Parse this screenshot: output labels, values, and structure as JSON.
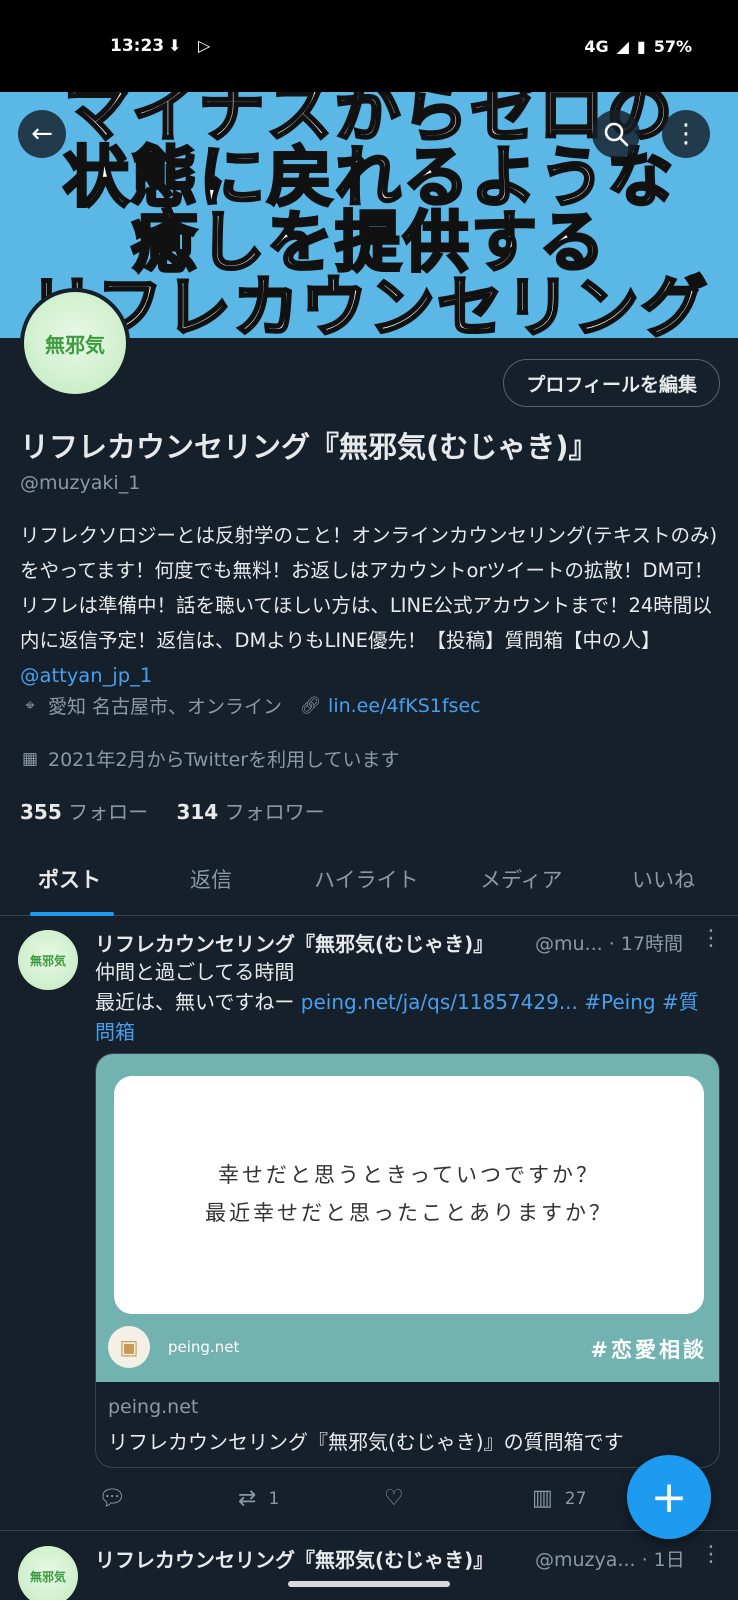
{
  "status_bar": {
    "time": "13:23",
    "network": "4G",
    "battery": "57%"
  },
  "banner": {
    "lines": [
      "マイナスからゼロの",
      "状態に戻れるような",
      "癒しを提供する",
      "リフレカウンセリング"
    ]
  },
  "profile": {
    "avatar_text": "無邪気",
    "edit_button": "プロフィールを編集",
    "name": "リフレカウンセリング『無邪気(むじゃき)』",
    "handle": "@muzyaki_1",
    "bio": "リフレクソロジーとは反射学のこと！オンラインカウンセリング(テキストのみ)をやってます！何度でも無料！お返しはアカウントorツイートの拡散！DM可！リフレは準備中！話を聴いてほしい方は、LINE公式アカウントまで！24時間以内に返信予定！返信は、DMよりもLINE優先！【投稿】質問箱【中の人】",
    "bio_mention": "@attyan_jp_1",
    "location": "愛知 名古屋市、オンライン",
    "website": "lin.ee/4fKS1fsec",
    "joined": "2021年2月からTwitterを利用しています",
    "following_count": "355",
    "following_label": "フォロー",
    "followers_count": "314",
    "followers_label": "フォロワー"
  },
  "tabs": [
    "ポスト",
    "返信",
    "ハイライト",
    "メディア",
    "いいね"
  ],
  "post1": {
    "name": "リフレカウンセリング『無邪気(むじゃき)』",
    "handle_time": "@mu... · 17時間",
    "line1": "仲間と過ごしてる時間",
    "line2_text": "最近は、無いですねー ",
    "line2_link": "peing.net/ja/qs/11857429...",
    "hashtag1": " #Peing",
    "hashtag2": " #質問箱",
    "card": {
      "question1": "幸せだと思うときっていつですか？",
      "question2": "最近幸せだと思ったことありますか？",
      "site_small": "peing.net",
      "tag": "#恋愛相談",
      "domain": "peing.net",
      "title": "リフレカウンセリング『無邪気(むじゃき)』の質問箱です"
    },
    "retweets": "1",
    "views": "27"
  },
  "post2": {
    "name": "リフレカウンセリング『無邪気(むじゃき)』",
    "handle_time": "@muzya... · 1日"
  }
}
